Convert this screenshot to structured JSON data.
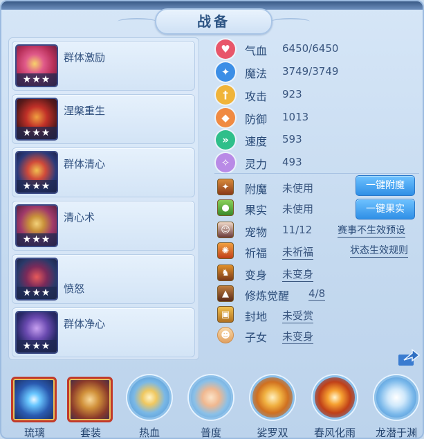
{
  "title": "战备",
  "skills": [
    {
      "name": "群体激励",
      "stars": "★★★",
      "icon": "feather-fan-icon"
    },
    {
      "name": "涅槃重生",
      "stars": "★★★",
      "icon": "phoenix-helmet-icon"
    },
    {
      "name": "群体清心",
      "stars": "★★★",
      "icon": "mask-icon"
    },
    {
      "name": "清心术",
      "stars": "★★★",
      "icon": "golden-chain-icon"
    },
    {
      "name": "愤怒",
      "stars": "★★★",
      "icon": "bracelet-icon"
    },
    {
      "name": "群体净心",
      "stars": "★★★",
      "icon": "purple-warrior-icon"
    }
  ],
  "attributes": [
    {
      "label": "气血",
      "value": "6450/6450",
      "icon": "heart-icon",
      "color": "#e8566a"
    },
    {
      "label": "魔法",
      "value": "3749/3749",
      "icon": "mana-icon",
      "color": "#3c8ee6"
    },
    {
      "label": "攻击",
      "value": "923",
      "icon": "sword-icon",
      "color": "#f0b43a"
    },
    {
      "label": "防御",
      "value": "1013",
      "icon": "shield-icon",
      "color": "#f08a42"
    },
    {
      "label": "速度",
      "value": "593",
      "icon": "speed-icon",
      "color": "#2fbf8a"
    },
    {
      "label": "灵力",
      "value": "493",
      "icon": "spirit-icon",
      "color": "#b98ae6"
    }
  ],
  "status": [
    {
      "label": "附魔",
      "value": "未使用",
      "underline": false,
      "icon": "enchant-icon"
    },
    {
      "label": "果实",
      "value": "未使用",
      "underline": false,
      "icon": "fruit-icon"
    },
    {
      "label": "宠物",
      "value": "11/12",
      "underline": false,
      "icon": "pet-icon"
    },
    {
      "label": "祈福",
      "value": "未祈福",
      "underline": true,
      "icon": "blessing-icon"
    },
    {
      "label": "变身",
      "value": "未变身",
      "underline": true,
      "icon": "transform-icon"
    },
    {
      "label": "修炼觉醒",
      "value": "4/8",
      "underline": true,
      "icon": "cultivation-icon"
    },
    {
      "label": "封地",
      "value": "未受赏",
      "underline": true,
      "icon": "fief-icon"
    },
    {
      "label": "子女",
      "value": "未变身",
      "underline": true,
      "icon": "child-icon"
    }
  ],
  "buttons": {
    "enchant": "一键附魔",
    "fruit": "一键果实"
  },
  "links": {
    "event_invalid": "赛事不生效预设",
    "status_rules": "状态生效规则"
  },
  "bottom_items": [
    {
      "label": "琉璃",
      "style": "square",
      "icon": "crystal-orb-icon"
    },
    {
      "label": "套装",
      "style": "square",
      "icon": "treasure-pot-icon"
    },
    {
      "label": "热血",
      "style": "round",
      "icon": "hot-blood-icon"
    },
    {
      "label": "普度",
      "style": "round",
      "icon": "palm-icon"
    },
    {
      "label": "娑罗双",
      "style": "round",
      "icon": "sal-tree-icon"
    },
    {
      "label": "春风化雨",
      "style": "round",
      "icon": "spring-rain-icon"
    },
    {
      "label": "龙潜于渊",
      "style": "round",
      "icon": "dragon-icon"
    }
  ]
}
